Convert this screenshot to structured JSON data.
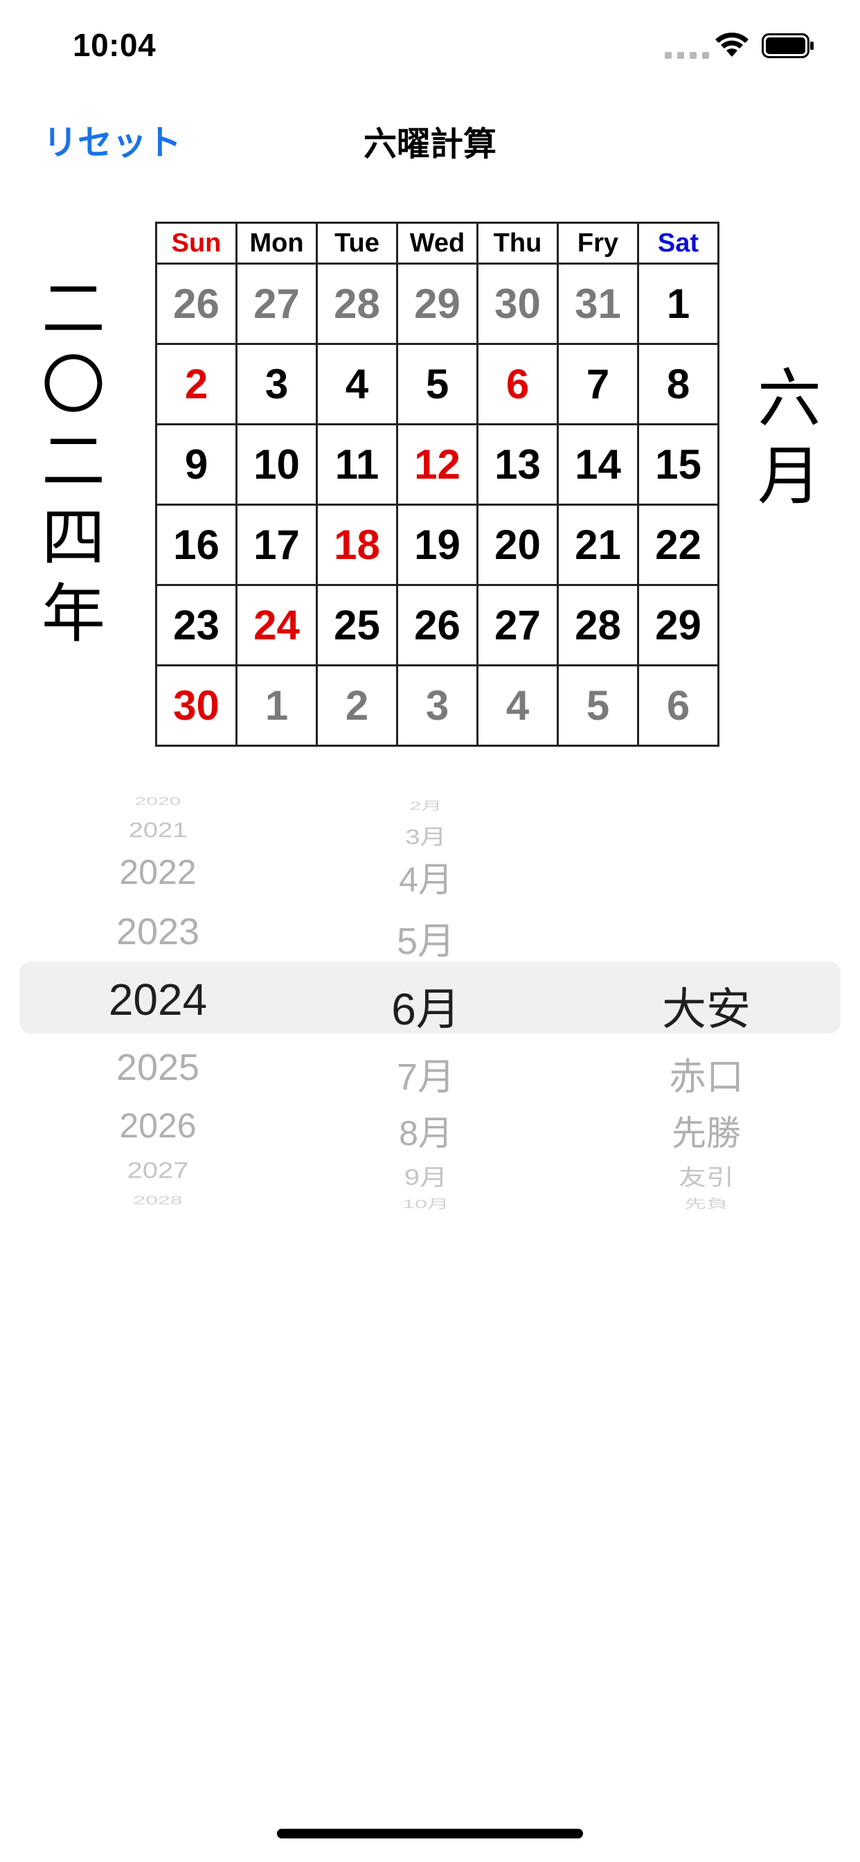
{
  "status": {
    "time": "10:04"
  },
  "nav": {
    "reset_label": "リセット",
    "title": "六曜計算"
  },
  "vertical_year": [
    "二",
    "〇",
    "二",
    "四",
    "年"
  ],
  "vertical_month": [
    "六",
    "月"
  ],
  "calendar": {
    "headers": [
      "Sun",
      "Mon",
      "Tue",
      "Wed",
      "Thu",
      "Fry",
      "Sat"
    ],
    "rows": [
      [
        "26",
        "27",
        "28",
        "29",
        "30",
        "31",
        "1"
      ],
      [
        "2",
        "3",
        "4",
        "5",
        "6",
        "7",
        "8"
      ],
      [
        "9",
        "10",
        "11",
        "12",
        "13",
        "14",
        "15"
      ],
      [
        "16",
        "17",
        "18",
        "19",
        "20",
        "21",
        "22"
      ],
      [
        "23",
        "24",
        "25",
        "26",
        "27",
        "28",
        "29"
      ],
      [
        "30",
        "1",
        "2",
        "3",
        "4",
        "5",
        "6"
      ]
    ]
  },
  "picker": {
    "years": [
      "2020",
      "2021",
      "2022",
      "2023",
      "2024",
      "2025",
      "2026",
      "2027",
      "2028"
    ],
    "months": [
      "2月",
      "3月",
      "4月",
      "5月",
      "6月",
      "7月",
      "8月",
      "9月",
      "10月"
    ],
    "rokuyo": [
      "大安",
      "赤口",
      "先勝",
      "友引",
      "先負"
    ],
    "selected_year": "2024",
    "selected_month": "6月",
    "selected_rokuyo": "大安"
  },
  "colors": {
    "accent": "#1a73e8",
    "sunday": "#e00000",
    "saturday": "#0a10d8",
    "other_month": "#7a7a7a"
  }
}
